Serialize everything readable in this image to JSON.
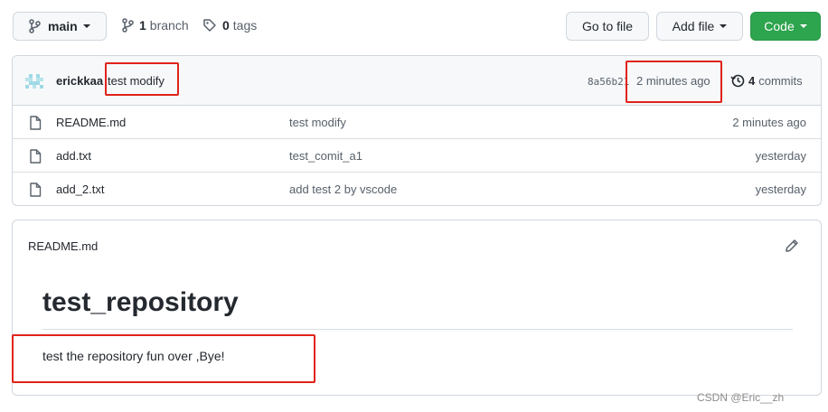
{
  "toolbar": {
    "branch_selector": "main",
    "branch_count": "1",
    "branch_word": "branch",
    "tag_count": "0",
    "tag_word": "tags",
    "goto_file": "Go to file",
    "add_file": "Add file",
    "code": "Code",
    "code_color": "#2da44e"
  },
  "latest_commit": {
    "author": "erickkaa",
    "message": "test modify",
    "sha": "8a56b21",
    "time": "2 minutes ago",
    "commits_count": "4",
    "commits_word": "commits"
  },
  "files": [
    {
      "name": "README.md",
      "message": "test modify",
      "age": "2 minutes ago"
    },
    {
      "name": "add.txt",
      "message": "test_comit_a1",
      "age": "yesterday"
    },
    {
      "name": "add_2.txt",
      "message": "add test 2 by vscode",
      "age": "yesterday"
    }
  ],
  "readme": {
    "filename": "README.md",
    "title": "test_repository",
    "body": "test the repository fun over ,Bye!"
  },
  "annotation_color": "#e0231a",
  "watermark": "CSDN @Eric__zh"
}
